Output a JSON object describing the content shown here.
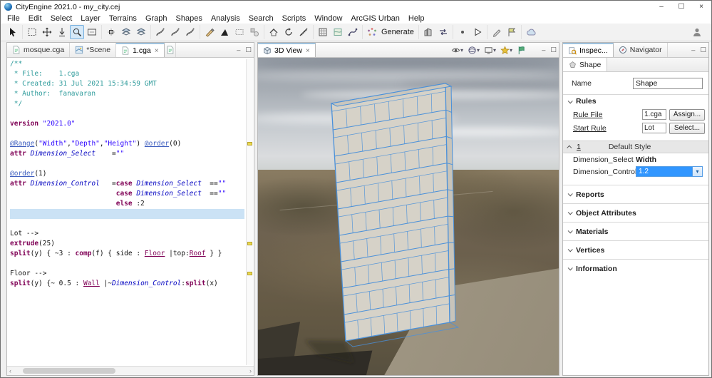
{
  "window": {
    "title": "CityEngine 2021.0 - my_city.cej"
  },
  "ui": {
    "minimize_glyph": "–",
    "maximize_glyph": "☐",
    "close_glyph": "×",
    "caret_down": "▾",
    "scroll_left": "‹",
    "scroll_right": "›"
  },
  "menu": {
    "items": [
      "File",
      "Edit",
      "Select",
      "Layer",
      "Terrains",
      "Graph",
      "Shapes",
      "Analysis",
      "Search",
      "Scripts",
      "Window",
      "ArcGIS Urban",
      "Help"
    ]
  },
  "toolbar": {
    "generate_label": "Generate",
    "groups": [
      [
        {
          "kind": "pointer",
          "name": "select-tool-icon"
        }
      ],
      [
        {
          "kind": "marquee",
          "name": "marquee-select-icon"
        },
        {
          "kind": "move",
          "name": "move-tool-icon"
        },
        {
          "kind": "downarrow",
          "name": "align-terrain-icon"
        },
        {
          "kind": "zoom",
          "name": "zoom-tool-icon",
          "active": true
        },
        {
          "kind": "frame",
          "name": "frame-view-icon"
        }
      ],
      [
        {
          "kind": "offset",
          "name": "offset-tool-icon"
        },
        {
          "kind": "layers",
          "name": "layer-tool-icon"
        },
        {
          "kind": "layers",
          "name": "layer-group-icon"
        }
      ],
      [
        {
          "kind": "road",
          "name": "street-create-icon"
        },
        {
          "kind": "road",
          "name": "street-edit-icon"
        },
        {
          "kind": "road",
          "name": "street-curve-icon"
        }
      ],
      [
        {
          "kind": "pencil",
          "name": "draw-line-icon"
        },
        {
          "kind": "triangle",
          "name": "draw-polygon-icon"
        },
        {
          "kind": "dashedrect",
          "name": "draw-rect-icon"
        },
        {
          "kind": "shapes",
          "name": "draw-shapes-icon"
        }
      ],
      [
        {
          "kind": "roof",
          "name": "push-pull-icon"
        },
        {
          "kind": "rotate",
          "name": "rotate-tool-icon"
        },
        {
          "kind": "measure",
          "name": "measure-tool-icon"
        }
      ],
      [
        {
          "kind": "grid",
          "name": "texture-tool-icon"
        },
        {
          "kind": "map",
          "name": "map-layer-icon"
        },
        {
          "kind": "curve",
          "name": "graph-edit-icon"
        }
      ],
      [
        {
          "kind": "dots",
          "name": "generate-icon",
          "label": true
        }
      ],
      [
        {
          "kind": "building",
          "name": "model-export-icon"
        },
        {
          "kind": "swap",
          "name": "swap-model-icon"
        }
      ],
      [
        {
          "kind": "dot",
          "name": "point-tool-icon"
        },
        {
          "kind": "play",
          "name": "play-script-icon"
        }
      ],
      [
        {
          "kind": "pencil2",
          "name": "annotate-icon"
        },
        {
          "kind": "flag2",
          "name": "flag-tool-icon"
        }
      ],
      [
        {
          "kind": "cloud",
          "name": "cloud-share-icon"
        }
      ]
    ]
  },
  "editor": {
    "tabs": [
      {
        "label": "mosque.cga",
        "icon": "cga",
        "active": false,
        "close": false,
        "partial": false
      },
      {
        "label": "*Scene",
        "icon": "scene",
        "active": false,
        "close": false,
        "partial": false
      },
      {
        "label": "1.cga",
        "icon": "cga",
        "active": true,
        "close": true,
        "partial": false
      },
      {
        "label": "",
        "icon": "cga",
        "active": false,
        "close": false,
        "partial": true
      }
    ],
    "markers": [
      9,
      19,
      22
    ],
    "lines": [
      {
        "tk": [
          {
            "c": "cm",
            "t": "/**"
          }
        ]
      },
      {
        "tk": [
          {
            "c": "cm",
            "t": " * File:    1.cga"
          }
        ]
      },
      {
        "tk": [
          {
            "c": "cm",
            "t": " * Created: 31 Jul 2021 15:34:59 GMT"
          }
        ]
      },
      {
        "tk": [
          {
            "c": "cm",
            "t": " * Author:  fanavaran"
          }
        ]
      },
      {
        "tk": [
          {
            "c": "cm",
            "t": " */"
          }
        ]
      },
      {
        "tk": []
      },
      {
        "tk": [
          {
            "c": "kw",
            "t": "version "
          },
          {
            "c": "str",
            "t": "\"2021.0\""
          }
        ]
      },
      {
        "tk": []
      },
      {
        "tk": [
          {
            "c": "ann",
            "t": "@Range"
          },
          {
            "c": "pl",
            "t": "("
          },
          {
            "c": "str",
            "t": "\"Width\""
          },
          {
            "c": "pl",
            "t": ","
          },
          {
            "c": "str",
            "t": "\"Depth\""
          },
          {
            "c": "pl",
            "t": ","
          },
          {
            "c": "str",
            "t": "\"Height\""
          },
          {
            "c": "pl",
            "t": ") "
          },
          {
            "c": "ann",
            "t": "@order"
          },
          {
            "c": "pl",
            "t": "(0)"
          }
        ]
      },
      {
        "tk": [
          {
            "c": "kw",
            "t": "attr "
          },
          {
            "c": "var",
            "t": "Dimension_Select"
          },
          {
            "c": "pl",
            "t": "    ="
          },
          {
            "c": "str",
            "t": "\"\""
          }
        ]
      },
      {
        "tk": []
      },
      {
        "tk": [
          {
            "c": "ann",
            "t": "@order"
          },
          {
            "c": "pl",
            "t": "(1)"
          }
        ]
      },
      {
        "tk": [
          {
            "c": "kw",
            "t": "attr "
          },
          {
            "c": "var",
            "t": "Dimension_Control"
          },
          {
            "c": "pl",
            "t": "   ="
          },
          {
            "c": "kw",
            "t": "case "
          },
          {
            "c": "var",
            "t": "Dimension_Select"
          },
          {
            "c": "pl",
            "t": "  =="
          },
          {
            "c": "str",
            "t": "\"\""
          }
        ]
      },
      {
        "tk": [
          {
            "c": "pl",
            "t": "                          "
          },
          {
            "c": "kw",
            "t": "case "
          },
          {
            "c": "var",
            "t": "Dimension_Select"
          },
          {
            "c": "pl",
            "t": "  =="
          },
          {
            "c": "str",
            "t": "\"\""
          }
        ]
      },
      {
        "tk": [
          {
            "c": "pl",
            "t": "                          "
          },
          {
            "c": "kw",
            "t": "else"
          },
          {
            "c": "pl",
            "t": " :2"
          }
        ]
      },
      {
        "hl": true,
        "tk": []
      },
      {
        "tk": []
      },
      {
        "tk": [
          {
            "c": "pl",
            "t": "Lot --> "
          }
        ]
      },
      {
        "tk": [
          {
            "c": "kw",
            "t": "extrude"
          },
          {
            "c": "pl",
            "t": "(25)"
          }
        ]
      },
      {
        "tk": [
          {
            "c": "kw",
            "t": "split"
          },
          {
            "c": "pl",
            "t": "(y) { ~3 : "
          },
          {
            "c": "kw",
            "t": "comp"
          },
          {
            "c": "pl",
            "t": "(f) { side : "
          },
          {
            "c": "rule",
            "t": "Floor"
          },
          {
            "c": "pl",
            "t": " |top:"
          },
          {
            "c": "rule",
            "t": "Roof"
          },
          {
            "c": "pl",
            "t": " } }"
          }
        ]
      },
      {
        "tk": []
      },
      {
        "tk": [
          {
            "c": "pl",
            "t": "Floor --> "
          }
        ]
      },
      {
        "tk": [
          {
            "c": "kw",
            "t": "split"
          },
          {
            "c": "pl",
            "t": "(y) {~ 0.5 : "
          },
          {
            "c": "rule",
            "t": "Wall"
          },
          {
            "c": "pl",
            "t": " |~"
          },
          {
            "c": "var",
            "t": "Dimension_Control"
          },
          {
            "c": "pl",
            "t": ":"
          },
          {
            "c": "kw",
            "t": "split"
          },
          {
            "c": "pl",
            "t": "(x)"
          }
        ]
      }
    ]
  },
  "viewport": {
    "tab_label": "3D View",
    "tools": [
      {
        "kind": "eye",
        "name": "visibility-settings-icon",
        "caret": true
      },
      {
        "kind": "sphere",
        "name": "render-mode-icon",
        "caret": true
      },
      {
        "kind": "monitor",
        "name": "viewport-layout-icon",
        "caret": true
      },
      {
        "kind": "star",
        "name": "bookmarks-icon",
        "caret": true
      },
      {
        "kind": "flag",
        "name": "flags-icon",
        "caret": false
      }
    ],
    "scene": {
      "sky_top": "#949ba4",
      "sky_horizon": "#dadcde",
      "terrain_base": "#6e6250",
      "terrain_light": "#a79e8b",
      "terrain_dark": "#3b372e",
      "building_face": "#d6d2c8",
      "building_side": "#c8c4ba",
      "building_top": "#cac6bc",
      "wire": "#4a90d9",
      "floors": 9,
      "windows": 8
    }
  },
  "inspector": {
    "tab_label": "Inspec...",
    "navigator_label": "Navigator",
    "shape_tab": "Shape",
    "name_label": "Name",
    "name_value": "Shape",
    "rules_header": "Rules",
    "rule_file_label": "Rule File",
    "rule_file_value": "1.cga",
    "assign_button": "Assign...",
    "start_rule_label": "Start Rule",
    "start_rule_value": "Lot",
    "select_button": "Select...",
    "group_index": "1",
    "group_style": "Default Style",
    "attr_rows": [
      {
        "label": "Dimension_Select",
        "value": "Width",
        "editing": false
      },
      {
        "label": "Dimension_Control",
        "value": "1.2",
        "editing": true
      }
    ],
    "collapsed_sections": [
      "Reports",
      "Object Attributes",
      "Materials",
      "Vertices",
      "Information"
    ]
  }
}
